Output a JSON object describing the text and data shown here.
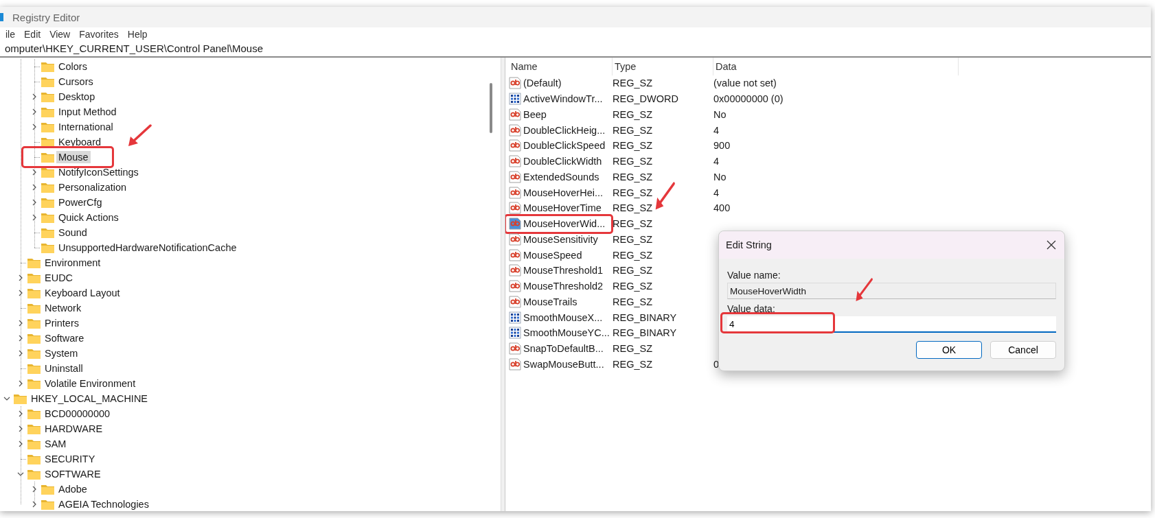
{
  "window": {
    "title": "Registry Editor"
  },
  "menu": [
    "ile",
    "Edit",
    "View",
    "Favorites",
    "Help"
  ],
  "address": "omputer\\HKEY_CURRENT_USER\\Control Panel\\Mouse",
  "tree": [
    {
      "children": [
        {
          "children": [
            {
              "label": "Colors",
              "kind": "leaf",
              "selected": false,
              "highlighted": false
            },
            {
              "label": "Cursors",
              "kind": "leaf",
              "selected": false,
              "highlighted": false
            },
            {
              "label": "Desktop",
              "kind": "branch",
              "expanded": false,
              "selected": false,
              "highlighted": false
            },
            {
              "label": "Input Method",
              "kind": "branch",
              "expanded": false,
              "selected": false,
              "highlighted": false
            },
            {
              "label": "International",
              "kind": "branch",
              "expanded": false,
              "selected": false,
              "highlighted": false
            },
            {
              "label": "Keyboard",
              "kind": "leaf",
              "selected": false,
              "highlighted": false
            },
            {
              "label": "Mouse",
              "kind": "leaf",
              "selected": true,
              "highlighted": true
            },
            {
              "label": "NotifyIconSettings",
              "kind": "branch",
              "expanded": false,
              "selected": false,
              "highlighted": false
            },
            {
              "label": "Personalization",
              "kind": "branch",
              "expanded": false,
              "selected": false,
              "highlighted": false
            },
            {
              "label": "PowerCfg",
              "kind": "branch",
              "expanded": false,
              "selected": false,
              "highlighted": false
            },
            {
              "label": "Quick Actions",
              "kind": "branch",
              "expanded": false,
              "selected": false,
              "highlighted": false
            },
            {
              "label": "Sound",
              "kind": "leaf",
              "selected": false,
              "highlighted": false
            },
            {
              "label": "UnsupportedHardwareNotificationCache",
              "kind": "leaf",
              "selected": false,
              "highlighted": false
            }
          ]
        },
        {
          "label": "Environment",
          "kind": "leaf",
          "selected": false,
          "highlighted": false
        },
        {
          "label": "EUDC",
          "kind": "branch",
          "expanded": false,
          "selected": false,
          "highlighted": false
        },
        {
          "label": "Keyboard Layout",
          "kind": "branch",
          "expanded": false,
          "selected": false,
          "highlighted": false
        },
        {
          "label": "Network",
          "kind": "leaf",
          "selected": false,
          "highlighted": false
        },
        {
          "label": "Printers",
          "kind": "branch",
          "expanded": false,
          "selected": false,
          "highlighted": false
        },
        {
          "label": "Software",
          "kind": "branch",
          "expanded": false,
          "selected": false,
          "highlighted": false
        },
        {
          "label": "System",
          "kind": "branch",
          "expanded": false,
          "selected": false,
          "highlighted": false
        },
        {
          "label": "Uninstall",
          "kind": "leaf",
          "selected": false,
          "highlighted": false
        },
        {
          "label": "Volatile Environment",
          "kind": "branch",
          "expanded": false,
          "selected": false,
          "highlighted": false
        }
      ]
    },
    {
      "label": "HKEY_LOCAL_MACHINE",
      "kind": "branch",
      "expanded": true,
      "selected": false,
      "highlighted": false,
      "children": [
        {
          "label": "BCD00000000",
          "kind": "branch",
          "expanded": false,
          "selected": false,
          "highlighted": false
        },
        {
          "label": "HARDWARE",
          "kind": "branch",
          "expanded": false,
          "selected": false,
          "highlighted": false
        },
        {
          "label": "SAM",
          "kind": "branch",
          "expanded": false,
          "selected": false,
          "highlighted": false
        },
        {
          "label": "SECURITY",
          "kind": "leaf",
          "selected": false,
          "highlighted": false
        },
        {
          "label": "SOFTWARE",
          "kind": "branch",
          "expanded": true,
          "selected": false,
          "highlighted": false,
          "children": [
            {
              "label": "Adobe",
              "kind": "branch",
              "expanded": false,
              "selected": false,
              "highlighted": false
            },
            {
              "label": "AGEIA Technologies",
              "kind": "branch",
              "expanded": false,
              "selected": false,
              "highlighted": false
            }
          ]
        }
      ]
    }
  ],
  "values": {
    "columns": [
      "Name",
      "Type",
      "Data"
    ],
    "rows": [
      {
        "name": "(Default)",
        "type": "REG_SZ",
        "data": "(value not set)",
        "kind": "string",
        "selected": false,
        "highlighted": false
      },
      {
        "name": "ActiveWindowTr...",
        "type": "REG_DWORD",
        "data": "0x00000000 (0)",
        "kind": "binary",
        "selected": false,
        "highlighted": false
      },
      {
        "name": "Beep",
        "type": "REG_SZ",
        "data": "No",
        "kind": "string",
        "selected": false,
        "highlighted": false
      },
      {
        "name": "DoubleClickHeig...",
        "type": "REG_SZ",
        "data": "4",
        "kind": "string",
        "selected": false,
        "highlighted": false
      },
      {
        "name": "DoubleClickSpeed",
        "type": "REG_SZ",
        "data": "900",
        "kind": "string",
        "selected": false,
        "highlighted": false
      },
      {
        "name": "DoubleClickWidth",
        "type": "REG_SZ",
        "data": "4",
        "kind": "string",
        "selected": false,
        "highlighted": false
      },
      {
        "name": "ExtendedSounds",
        "type": "REG_SZ",
        "data": "No",
        "kind": "string",
        "selected": false,
        "highlighted": false
      },
      {
        "name": "MouseHoverHei...",
        "type": "REG_SZ",
        "data": "4",
        "kind": "string",
        "selected": false,
        "highlighted": false
      },
      {
        "name": "MouseHoverTime",
        "type": "REG_SZ",
        "data": "400",
        "kind": "string",
        "selected": false,
        "highlighted": false
      },
      {
        "name": "MouseHoverWid...",
        "type": "REG_SZ",
        "kind": "string",
        "selected": true,
        "highlighted": true
      },
      {
        "name": "MouseSensitivity",
        "type": "REG_SZ",
        "kind": "string",
        "selected": false,
        "highlighted": false
      },
      {
        "name": "MouseSpeed",
        "type": "REG_SZ",
        "kind": "string",
        "selected": false,
        "highlighted": false
      },
      {
        "name": "MouseThreshold1",
        "type": "REG_SZ",
        "kind": "string",
        "selected": false,
        "highlighted": false
      },
      {
        "name": "MouseThreshold2",
        "type": "REG_SZ",
        "kind": "string",
        "selected": false,
        "highlighted": false
      },
      {
        "name": "MouseTrails",
        "type": "REG_SZ",
        "kind": "string",
        "selected": false,
        "highlighted": false
      },
      {
        "name": "SmoothMouseX...",
        "type": "REG_BINARY",
        "kind": "binary",
        "selected": false,
        "highlighted": false
      },
      {
        "name": "SmoothMouseYC...",
        "type": "REG_BINARY",
        "kind": "binary",
        "selected": false,
        "highlighted": false
      },
      {
        "name": "SnapToDefaultB...",
        "type": "REG_SZ",
        "kind": "string",
        "selected": false,
        "highlighted": false
      },
      {
        "name": "SwapMouseButt...",
        "type": "REG_SZ",
        "data": "0",
        "kind": "string",
        "selected": false,
        "highlighted": false
      }
    ]
  },
  "dialog": {
    "title": "Edit String",
    "name_label": "Value name:",
    "name_value": "MouseHoverWidth",
    "data_label": "Value data:",
    "data_value": "4",
    "data_highlighted": true,
    "buttons": [
      {
        "label": "OK",
        "default": true
      },
      {
        "label": "Cancel",
        "default": false
      }
    ]
  }
}
